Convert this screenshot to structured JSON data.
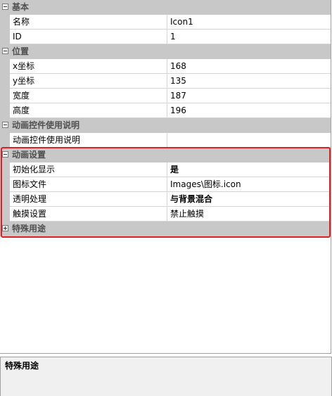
{
  "categories": {
    "basic": {
      "label": "基本",
      "rows": [
        {
          "name": "名称",
          "value": "Icon1"
        },
        {
          "name": "ID",
          "value": "1"
        }
      ]
    },
    "position": {
      "label": "位置",
      "rows": [
        {
          "name": "x坐标",
          "value": "168"
        },
        {
          "name": "y坐标",
          "value": "135"
        },
        {
          "name": "宽度",
          "value": "187"
        },
        {
          "name": "高度",
          "value": "196"
        }
      ]
    },
    "anim_help": {
      "label": "动画控件使用说明",
      "rows": [
        {
          "name": "动画控件使用说明",
          "value": ""
        }
      ]
    },
    "anim_settings": {
      "label": "动画设置",
      "rows": [
        {
          "name": "初始化显示",
          "value": "是"
        },
        {
          "name": "图标文件",
          "value": "Images\\图标.icon"
        },
        {
          "name": "透明处理",
          "value": "与背景混合"
        },
        {
          "name": "触摸设置",
          "value": "禁止触摸"
        }
      ]
    },
    "special": {
      "label": "特殊用途"
    }
  },
  "description": {
    "title": "特殊用途"
  },
  "colors": {
    "category_bg": "#c8c8c8",
    "highlight_border": "#e02020"
  },
  "icons": {
    "expanded": "minus-box",
    "collapsed": "plus-box"
  }
}
